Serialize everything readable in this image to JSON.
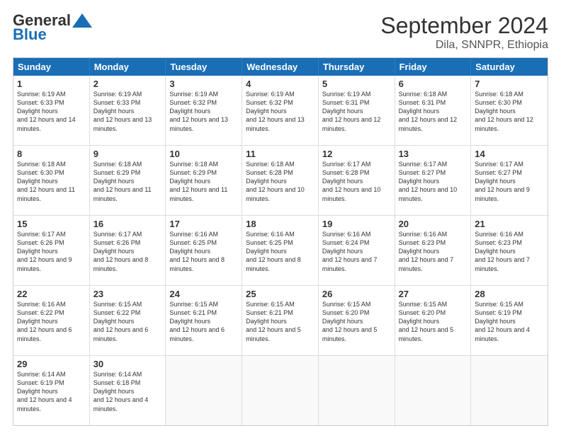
{
  "header": {
    "logo": {
      "general": "General",
      "blue": "Blue"
    },
    "title": "September 2024",
    "location": "Dila, SNNPR, Ethiopia"
  },
  "days": [
    "Sunday",
    "Monday",
    "Tuesday",
    "Wednesday",
    "Thursday",
    "Friday",
    "Saturday"
  ],
  "weeks": [
    [
      {
        "day": "1",
        "sunrise": "6:19 AM",
        "sunset": "6:33 PM",
        "daylight": "12 hours and 14 minutes."
      },
      {
        "day": "2",
        "sunrise": "6:19 AM",
        "sunset": "6:33 PM",
        "daylight": "12 hours and 13 minutes."
      },
      {
        "day": "3",
        "sunrise": "6:19 AM",
        "sunset": "6:32 PM",
        "daylight": "12 hours and 13 minutes."
      },
      {
        "day": "4",
        "sunrise": "6:19 AM",
        "sunset": "6:32 PM",
        "daylight": "12 hours and 13 minutes."
      },
      {
        "day": "5",
        "sunrise": "6:19 AM",
        "sunset": "6:31 PM",
        "daylight": "12 hours and 12 minutes."
      },
      {
        "day": "6",
        "sunrise": "6:18 AM",
        "sunset": "6:31 PM",
        "daylight": "12 hours and 12 minutes."
      },
      {
        "day": "7",
        "sunrise": "6:18 AM",
        "sunset": "6:30 PM",
        "daylight": "12 hours and 12 minutes."
      }
    ],
    [
      {
        "day": "8",
        "sunrise": "6:18 AM",
        "sunset": "6:30 PM",
        "daylight": "12 hours and 11 minutes."
      },
      {
        "day": "9",
        "sunrise": "6:18 AM",
        "sunset": "6:29 PM",
        "daylight": "12 hours and 11 minutes."
      },
      {
        "day": "10",
        "sunrise": "6:18 AM",
        "sunset": "6:29 PM",
        "daylight": "12 hours and 11 minutes."
      },
      {
        "day": "11",
        "sunrise": "6:18 AM",
        "sunset": "6:28 PM",
        "daylight": "12 hours and 10 minutes."
      },
      {
        "day": "12",
        "sunrise": "6:17 AM",
        "sunset": "6:28 PM",
        "daylight": "12 hours and 10 minutes."
      },
      {
        "day": "13",
        "sunrise": "6:17 AM",
        "sunset": "6:27 PM",
        "daylight": "12 hours and 10 minutes."
      },
      {
        "day": "14",
        "sunrise": "6:17 AM",
        "sunset": "6:27 PM",
        "daylight": "12 hours and 9 minutes."
      }
    ],
    [
      {
        "day": "15",
        "sunrise": "6:17 AM",
        "sunset": "6:26 PM",
        "daylight": "12 hours and 9 minutes."
      },
      {
        "day": "16",
        "sunrise": "6:17 AM",
        "sunset": "6:26 PM",
        "daylight": "12 hours and 8 minutes."
      },
      {
        "day": "17",
        "sunrise": "6:16 AM",
        "sunset": "6:25 PM",
        "daylight": "12 hours and 8 minutes."
      },
      {
        "day": "18",
        "sunrise": "6:16 AM",
        "sunset": "6:25 PM",
        "daylight": "12 hours and 8 minutes."
      },
      {
        "day": "19",
        "sunrise": "6:16 AM",
        "sunset": "6:24 PM",
        "daylight": "12 hours and 7 minutes."
      },
      {
        "day": "20",
        "sunrise": "6:16 AM",
        "sunset": "6:23 PM",
        "daylight": "12 hours and 7 minutes."
      },
      {
        "day": "21",
        "sunrise": "6:16 AM",
        "sunset": "6:23 PM",
        "daylight": "12 hours and 7 minutes."
      }
    ],
    [
      {
        "day": "22",
        "sunrise": "6:16 AM",
        "sunset": "6:22 PM",
        "daylight": "12 hours and 6 minutes."
      },
      {
        "day": "23",
        "sunrise": "6:15 AM",
        "sunset": "6:22 PM",
        "daylight": "12 hours and 6 minutes."
      },
      {
        "day": "24",
        "sunrise": "6:15 AM",
        "sunset": "6:21 PM",
        "daylight": "12 hours and 6 minutes."
      },
      {
        "day": "25",
        "sunrise": "6:15 AM",
        "sunset": "6:21 PM",
        "daylight": "12 hours and 5 minutes."
      },
      {
        "day": "26",
        "sunrise": "6:15 AM",
        "sunset": "6:20 PM",
        "daylight": "12 hours and 5 minutes."
      },
      {
        "day": "27",
        "sunrise": "6:15 AM",
        "sunset": "6:20 PM",
        "daylight": "12 hours and 5 minutes."
      },
      {
        "day": "28",
        "sunrise": "6:15 AM",
        "sunset": "6:19 PM",
        "daylight": "12 hours and 4 minutes."
      }
    ],
    [
      {
        "day": "29",
        "sunrise": "6:14 AM",
        "sunset": "6:19 PM",
        "daylight": "12 hours and 4 minutes."
      },
      {
        "day": "30",
        "sunrise": "6:14 AM",
        "sunset": "6:18 PM",
        "daylight": "12 hours and 4 minutes."
      },
      {
        "day": "",
        "sunrise": "",
        "sunset": "",
        "daylight": ""
      },
      {
        "day": "",
        "sunrise": "",
        "sunset": "",
        "daylight": ""
      },
      {
        "day": "",
        "sunrise": "",
        "sunset": "",
        "daylight": ""
      },
      {
        "day": "",
        "sunrise": "",
        "sunset": "",
        "daylight": ""
      },
      {
        "day": "",
        "sunrise": "",
        "sunset": "",
        "daylight": ""
      }
    ]
  ]
}
